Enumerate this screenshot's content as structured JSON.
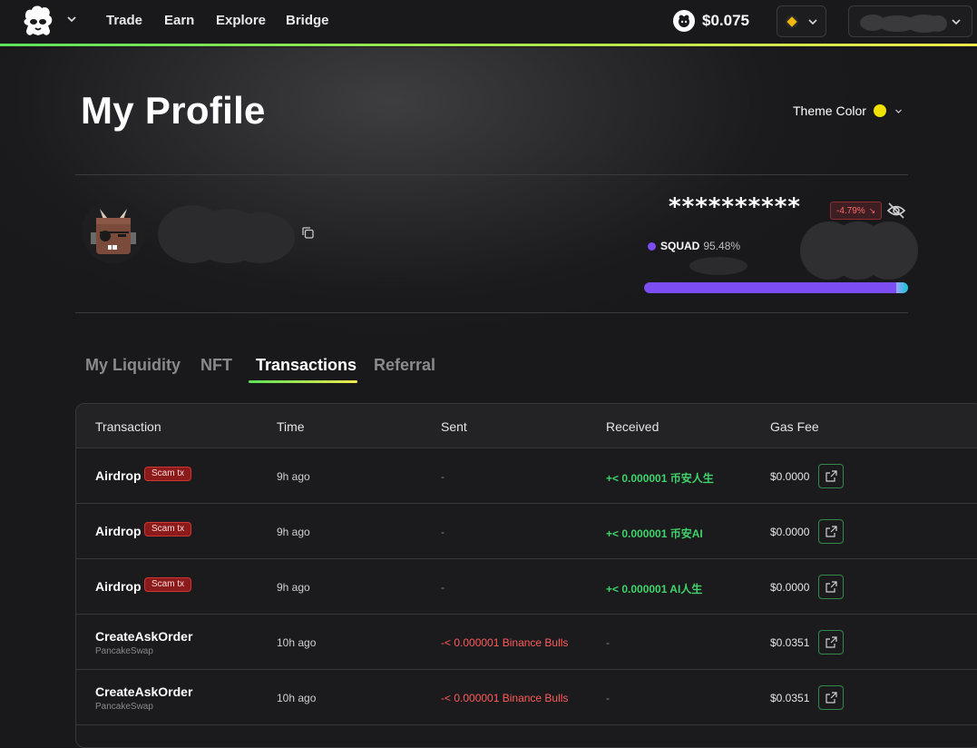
{
  "nav": {
    "links": [
      "Trade",
      "Earn",
      "Explore",
      "Bridge"
    ],
    "token_price": "$0.075"
  },
  "profile": {
    "title": "My Profile",
    "theme_label": "Theme Color",
    "theme_color": "#f0e100",
    "balance_masked": "**********",
    "change": "-4.79%",
    "squad_name": "SQUAD",
    "squad_pct": "95.48%",
    "squad_fraction": 0.955
  },
  "tabs": [
    "My Liquidity",
    "NFT",
    "Transactions",
    "Referral"
  ],
  "active_tab": "Transactions",
  "table": {
    "headers": [
      "Transaction",
      "Time",
      "Sent",
      "Received",
      "Gas Fee"
    ],
    "rows": [
      {
        "name": "Airdrop",
        "sub": "",
        "badge": "Scam tx",
        "time": "9h ago",
        "sent": "-",
        "received": "+< 0.000001 币安人生",
        "gas": "$0.0000"
      },
      {
        "name": "Airdrop",
        "sub": "",
        "badge": "Scam tx",
        "time": "9h ago",
        "sent": "-",
        "received": "+< 0.000001 币安AI",
        "gas": "$0.0000"
      },
      {
        "name": "Airdrop",
        "sub": "",
        "badge": "Scam tx",
        "time": "9h ago",
        "sent": "-",
        "received": "+< 0.000001 AI人生",
        "gas": "$0.0000"
      },
      {
        "name": "CreateAskOrder",
        "sub": "PancakeSwap",
        "badge": "",
        "time": "10h ago",
        "sent": "-< 0.000001 Binance Bulls",
        "received": "-",
        "gas": "$0.0351"
      },
      {
        "name": "CreateAskOrder",
        "sub": "PancakeSwap",
        "badge": "",
        "time": "10h ago",
        "sent": "-< 0.000001 Binance Bulls",
        "received": "-",
        "gas": "$0.0351"
      }
    ]
  },
  "colors": {
    "accent_green": "#41d36b",
    "negative_red": "#ff5b5b",
    "squad_purple": "#7b4df3"
  }
}
